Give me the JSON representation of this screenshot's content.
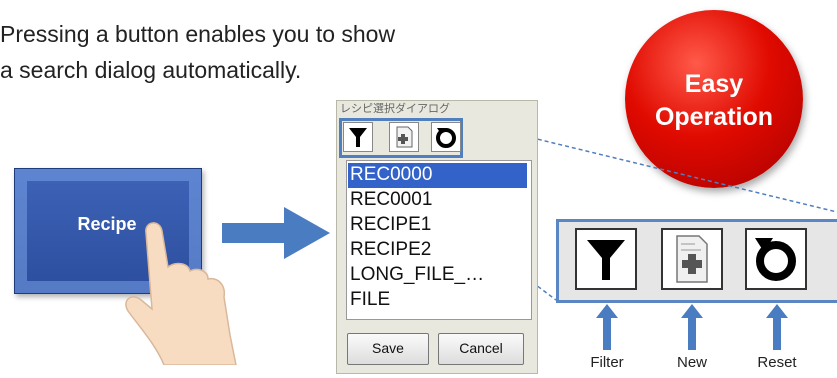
{
  "headline": {
    "line1": "Pressing a button enables you to show",
    "line2": "a search dialog automatically."
  },
  "badge": {
    "line1": "Easy",
    "line2": "Operation",
    "color": "#e00a00"
  },
  "recipe_button": {
    "label": "Recipe",
    "color": "#2f52a4"
  },
  "dialog": {
    "title": "レシピ選択ダイアログ",
    "toolbar_icons": [
      "filter-icon",
      "new-icon",
      "reset-icon"
    ],
    "items": [
      "REC0000",
      "REC0001",
      "RECIPE1",
      "RECIPE2",
      "LONG_FILE_…",
      "FILE"
    ],
    "selected_index": 0,
    "save_label": "Save",
    "cancel_label": "Cancel"
  },
  "zoom_toolbar": {
    "buttons": [
      {
        "icon": "filter-icon",
        "label": "Filter"
      },
      {
        "icon": "new-icon",
        "label": "New"
      },
      {
        "icon": "reset-icon",
        "label": "Reset"
      }
    ]
  }
}
